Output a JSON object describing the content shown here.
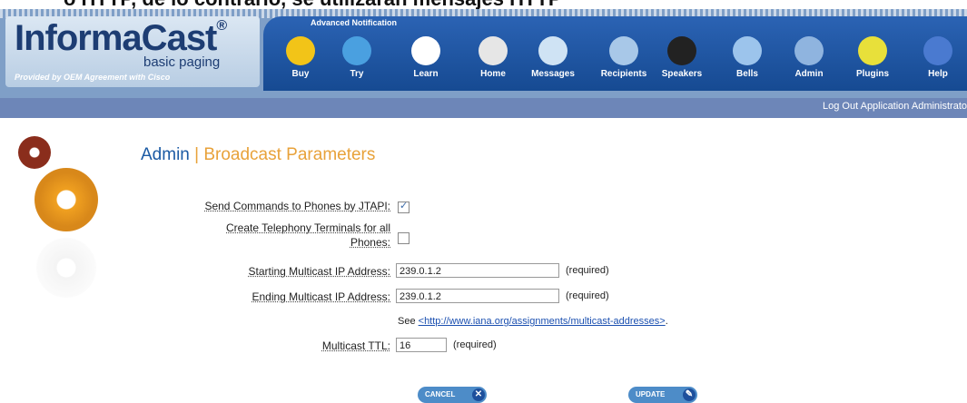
{
  "caption": "o HTTP, de lo contrario, se utilizarán mensajes HTTP",
  "logo": {
    "main": "InformaCast",
    "reg": "®",
    "sub": "basic paging",
    "tagline": "Provided by OEM Agreement with Cisco"
  },
  "nav": {
    "advanced_label": "Advanced Notification",
    "items": [
      {
        "label": "Buy",
        "icon": "buy-icon",
        "color": "#f2c418"
      },
      {
        "label": "Try",
        "icon": "try-icon",
        "color": "#4aa0e0"
      },
      {
        "label": "Learn",
        "icon": "learn-icon",
        "color": "#ffffff"
      },
      {
        "label": "Home",
        "icon": "home-icon",
        "color": "#e6e6e6"
      },
      {
        "label": "Messages",
        "icon": "messages-icon",
        "color": "#cfe3f4"
      },
      {
        "label": "Recipients",
        "icon": "recipients-icon",
        "color": "#a8c8e8"
      },
      {
        "label": "Speakers",
        "icon": "speakers-icon",
        "color": "#222222"
      },
      {
        "label": "Bells",
        "icon": "bells-icon",
        "color": "#9cc4ec"
      },
      {
        "label": "Admin",
        "icon": "admin-icon",
        "color": "#8fb4df"
      },
      {
        "label": "Plugins",
        "icon": "plugins-icon",
        "color": "#e8e03a"
      },
      {
        "label": "Help",
        "icon": "help-icon",
        "color": "#4a7ad0"
      }
    ]
  },
  "subbar": {
    "logout": "Log Out Application Administrato"
  },
  "page": {
    "section": "Admin",
    "separator": "|",
    "title": "Broadcast Parameters"
  },
  "form": {
    "jtapi_label": "Send Commands to Phones by JTAPI:",
    "jtapi_checked": true,
    "terminals_label_1": "Create Telephony Terminals for all",
    "terminals_label_2": "Phones:",
    "terminals_checked": false,
    "start_label": "Starting Multicast IP Address:",
    "start_value": "239.0.1.2",
    "end_label": "Ending Multicast IP Address:",
    "end_value": "239.0.1.2",
    "required": "(required)",
    "see_text": "See",
    "see_link": "<http://www.iana.org/assignments/multicast-addresses>",
    "see_after": ".",
    "ttl_label": "Multicast TTL:",
    "ttl_value": "16"
  },
  "buttons": {
    "cancel": "CANCEL",
    "update": "UPDATE"
  },
  "colors": {
    "header": "#7f9fc7",
    "nav": "#1f56a3",
    "title_blue": "#1b5aa4",
    "title_orange": "#e8a23a",
    "cancel_btn": "#4d8cc8",
    "update_btn": "#4d8cc8"
  }
}
